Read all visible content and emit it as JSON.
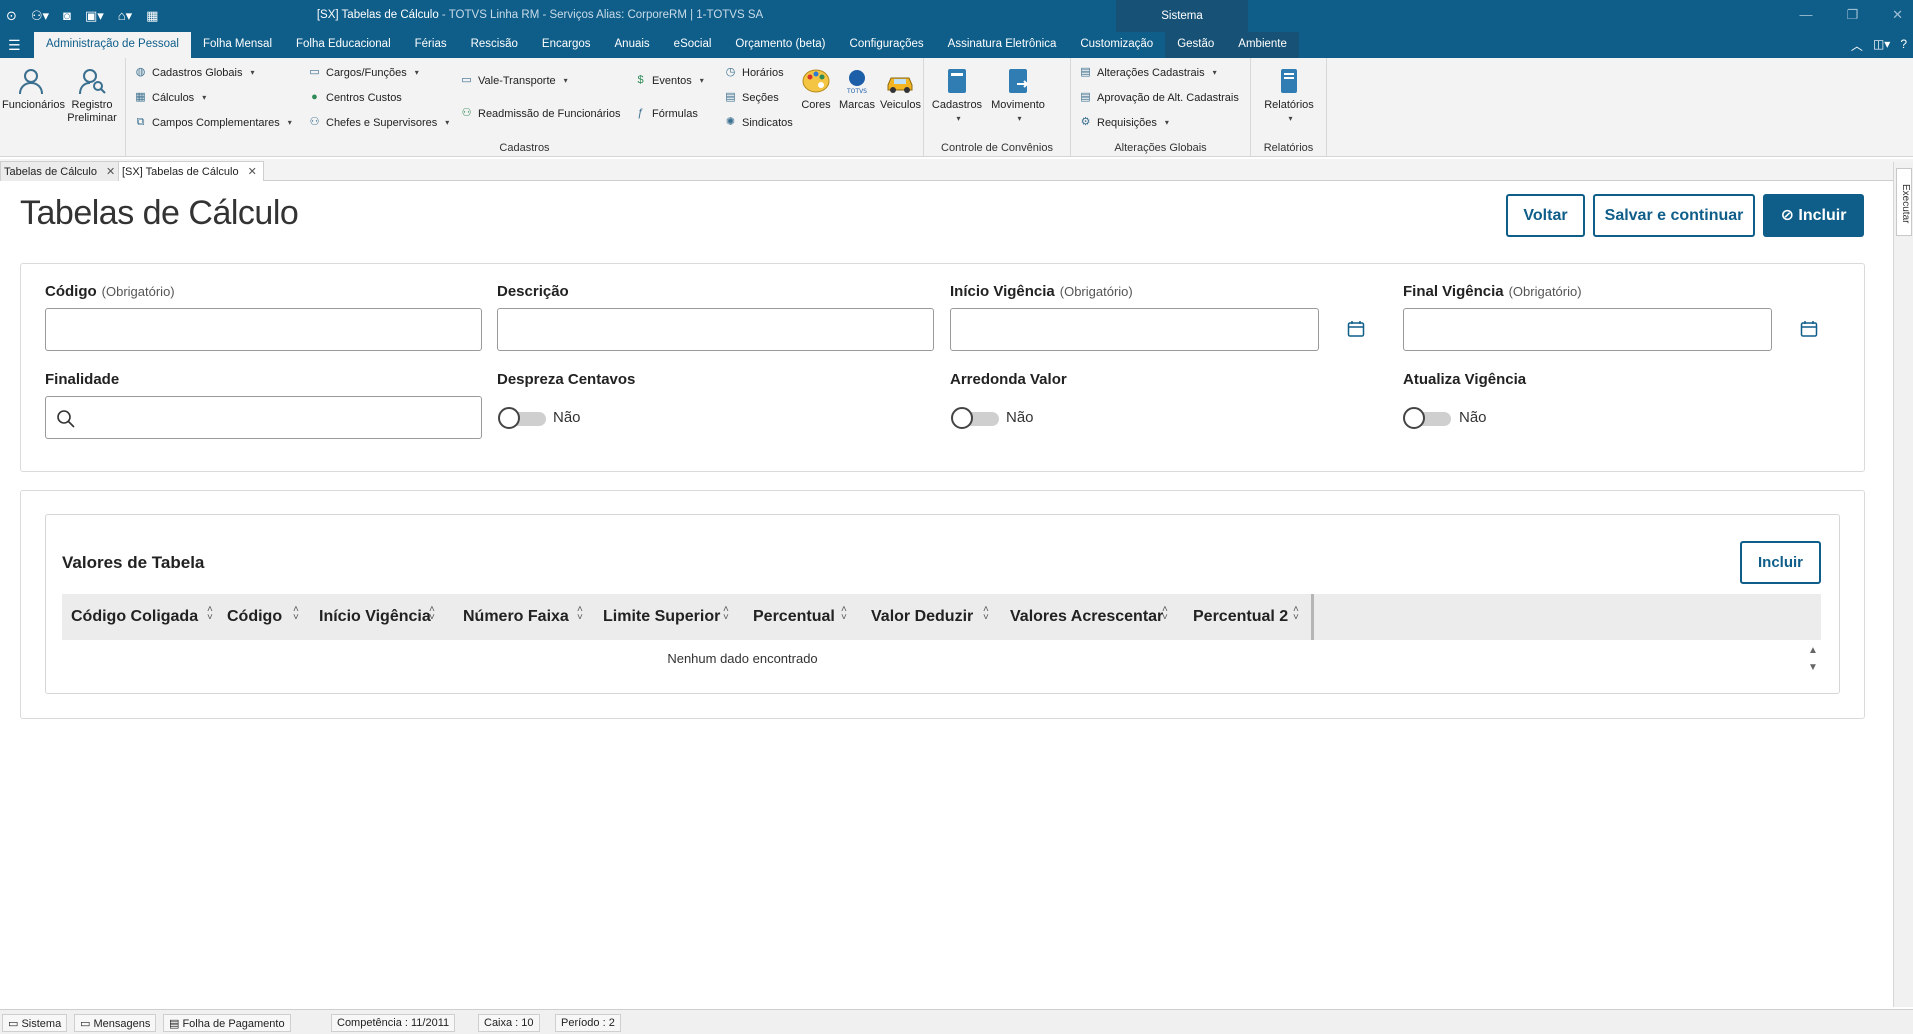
{
  "window": {
    "title": "[SX] Tabelas de Cálculo",
    "title_suffix": " - TOTVS Linha RM - Serviços  Alias: CorporeRM | 1-TOTVS SA",
    "sistema_label": "Sistema"
  },
  "menu": {
    "tabs": [
      "Administração de Pessoal",
      "Folha Mensal",
      "Folha Educacional",
      "Férias",
      "Rescisão",
      "Encargos",
      "Anuais",
      "eSocial",
      "Orçamento (beta)",
      "Configurações",
      "Assinatura Eletrônica",
      "Customização",
      "Gestão",
      "Ambiente"
    ],
    "active_index": 0
  },
  "ribbon": {
    "funcionarios": "Funcionários",
    "registro_preliminar": "Registro\nPreliminar",
    "cadastros_globais": "Cadastros Globais",
    "calculos": "Cálculos",
    "campos_complementares": "Campos Complementares",
    "cargos_funcoes": "Cargos/Funções",
    "centros_custos": "Centros Custos",
    "chefes_supervisores": "Chefes e Supervisores",
    "vale_transporte": "Vale-Transporte",
    "readmissao": "Readmissão de Funcionários",
    "eventos": "Eventos",
    "formulas": "Fórmulas",
    "horarios": "Horários",
    "secoes": "Seções",
    "sindicatos": "Sindicatos",
    "cores": "Cores",
    "marcas": "Marcas",
    "veiculos": "Veiculos",
    "group_cadastros": "Cadastros",
    "conv_cadastros": "Cadastros",
    "conv_movimento": "Movimento",
    "group_convenios": "Controle de Convênios",
    "alteracoes_cadastrais": "Alterações Cadastrais",
    "aprovacao_alt": "Aprovação de Alt. Cadastrais",
    "requisicoes": "Requisições",
    "group_alteracoes": "Alterações Globais",
    "relatorios": "Relatórios",
    "group_relatorios": "Relatórios"
  },
  "doc_tabs": [
    "Tabelas de Cálculo",
    "[SX] Tabelas de Cálculo"
  ],
  "sidebar": {
    "executar": "Executar"
  },
  "page": {
    "title": "Tabelas de Cálculo",
    "btn_voltar": "Voltar",
    "btn_salvar": "Salvar e continuar",
    "btn_incluir": "Incluir"
  },
  "form": {
    "codigo_label": "Código",
    "descricao_label": "Descrição",
    "inicio_label": "Início Vigência",
    "final_label": "Final Vigência",
    "required": "(Obrigatório)",
    "finalidade_label": "Finalidade",
    "despreza_label": "Despreza Centavos",
    "arredonda_label": "Arredonda Valor",
    "atualiza_label": "Atualiza Vigência",
    "despreza_value": "Não",
    "arredonda_value": "Não",
    "atualiza_value": "Não"
  },
  "table": {
    "title": "Valores de Tabela",
    "incluir": "Incluir",
    "columns": [
      "Código Coligada",
      "Código",
      "Início Vigência",
      "Número Faixa",
      "Limite Superior",
      "Percentual",
      "Valor Deduzir",
      "Valores Acrescentar",
      "Percentual 2"
    ],
    "empty": "Nenhum dado encontrado"
  },
  "status": {
    "sistema": "Sistema",
    "mensagens": "Mensagens",
    "folha": "Folha de Pagamento",
    "competencia": "Competência : 11/2011",
    "caixa": "Caixa : 10",
    "periodo": "Período : 2"
  }
}
